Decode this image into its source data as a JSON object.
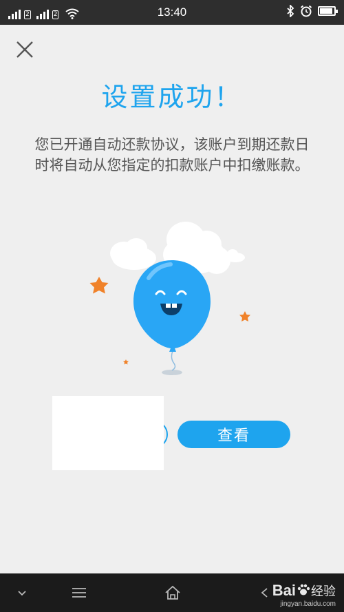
{
  "status_bar": {
    "time": "13:40",
    "sim1_tag": "2",
    "battery_level": 0.9
  },
  "main": {
    "title": "设置成功！",
    "description": "您已开通自动还款协议，该账户到期还款日时将自动从您指定的扣款账户中扣缴账款。",
    "view_button_label": "查看"
  },
  "watermark": {
    "brand": "Bai",
    "brand_suffix": "经验",
    "url": "jingyan.baidu.com"
  },
  "colors": {
    "accent": "#1ea4ee",
    "balloon": "#29a6f5",
    "star": "#f0822a",
    "status_bar": "#2e2e2e",
    "nav_bar": "#1b1b1b"
  },
  "icons": [
    "signal-icon",
    "wifi-icon",
    "bluetooth-icon",
    "alarm-icon",
    "battery-icon",
    "close-icon",
    "chevron-down-icon",
    "menu-icon",
    "home-icon",
    "back-icon"
  ]
}
